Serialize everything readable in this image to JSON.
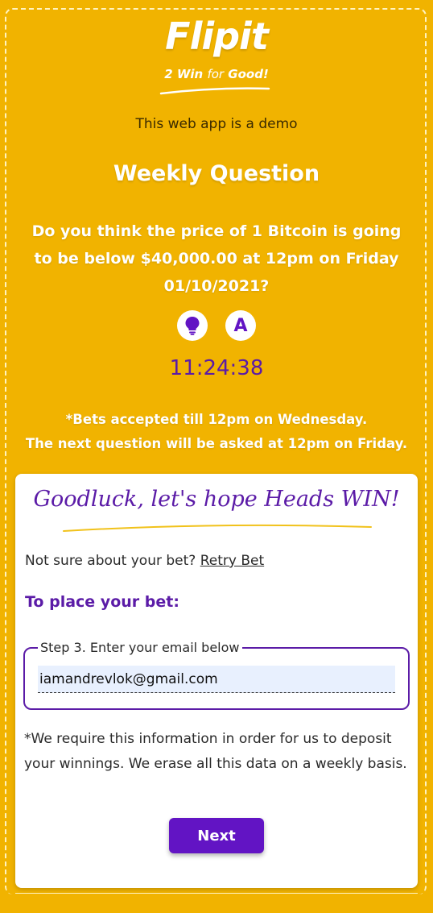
{
  "header": {
    "logo_title": "Flipit",
    "logo_sub_a": "2 Win ",
    "logo_sub_for": "for",
    "logo_sub_b": " Good!",
    "demo_notice": "This web app is a demo"
  },
  "weekly": {
    "title": "Weekly Question",
    "question": "Do you think the price of 1 Bitcoin is going to be below $40,000.00 at 12pm on Friday 01/10/2021?",
    "timer": "11:24:38",
    "bets_note": "*Bets accepted till 12pm on Wednesday.",
    "next_note": "The next question will be asked at 12pm on Friday.",
    "icons": [
      "lightbulb-icon",
      "answer-a-icon"
    ],
    "answer_letter": "A"
  },
  "card": {
    "heading": "Goodluck, let's hope Heads WIN!",
    "retry_prefix": "Not sure about your bet? ",
    "retry_link": "Retry Bet",
    "place_bet": "To place your bet:",
    "step_legend": "Step 3. Enter your email below",
    "email_value": "iamandrevlok@gmail.com",
    "disclaimer": "*We require this information in order for us to deposit your winnings. We erase all this data on a weekly basis.",
    "next_label": "Next"
  },
  "colors": {
    "background": "#f1b300",
    "accent_purple": "#5b1ba7",
    "button_purple": "#6214c4"
  }
}
